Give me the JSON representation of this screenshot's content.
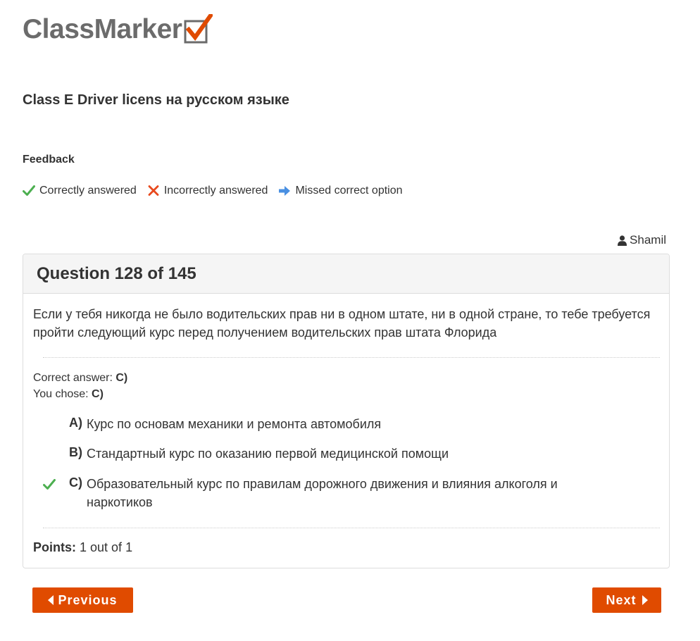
{
  "brand": {
    "name": "ClassMarker",
    "check_color": "#e04b00",
    "logo_text_color": "#6b6b6b"
  },
  "test": {
    "title": "Class E Driver licens на русском языке"
  },
  "feedback": {
    "heading": "Feedback",
    "legend": [
      {
        "icon": "check-icon",
        "label": "Correctly answered",
        "color": "#4caf50"
      },
      {
        "icon": "cross-icon",
        "label": "Incorrectly answered",
        "color": "#e8491d"
      },
      {
        "icon": "arrow-right-icon",
        "label": "Missed correct option",
        "color": "#4a90e2"
      }
    ]
  },
  "user": {
    "icon": "user-icon",
    "name": "Shamil"
  },
  "question": {
    "header": "Question 128 of 145",
    "text": "Если у тебя никогда не было водительских прав ни в одном штате, ни в одной стране, то тебе требуется пройти следующий курс перед получением водительских прав штата Флорида",
    "correct_answer_label": "Correct answer:",
    "correct_answer_value": "C)",
    "you_chose_label": "You chose:",
    "you_chose_value": "C)",
    "options": [
      {
        "letter": "A)",
        "text": "Курс по основам механики и ремонта автомобиля",
        "mark": ""
      },
      {
        "letter": "B)",
        "text": "Стандартный курс по оказанию первой медицинской помощи",
        "mark": ""
      },
      {
        "letter": "C)",
        "text": "Образовательный курс по правилам дорожного движения и влияния алкоголя и наркотиков",
        "mark": "check-icon"
      }
    ],
    "points_label": "Points:",
    "points_value": "1 out of 1"
  },
  "navigation": {
    "previous_label": "Previous",
    "next_label": "Next",
    "button_color": "#e04b00"
  }
}
